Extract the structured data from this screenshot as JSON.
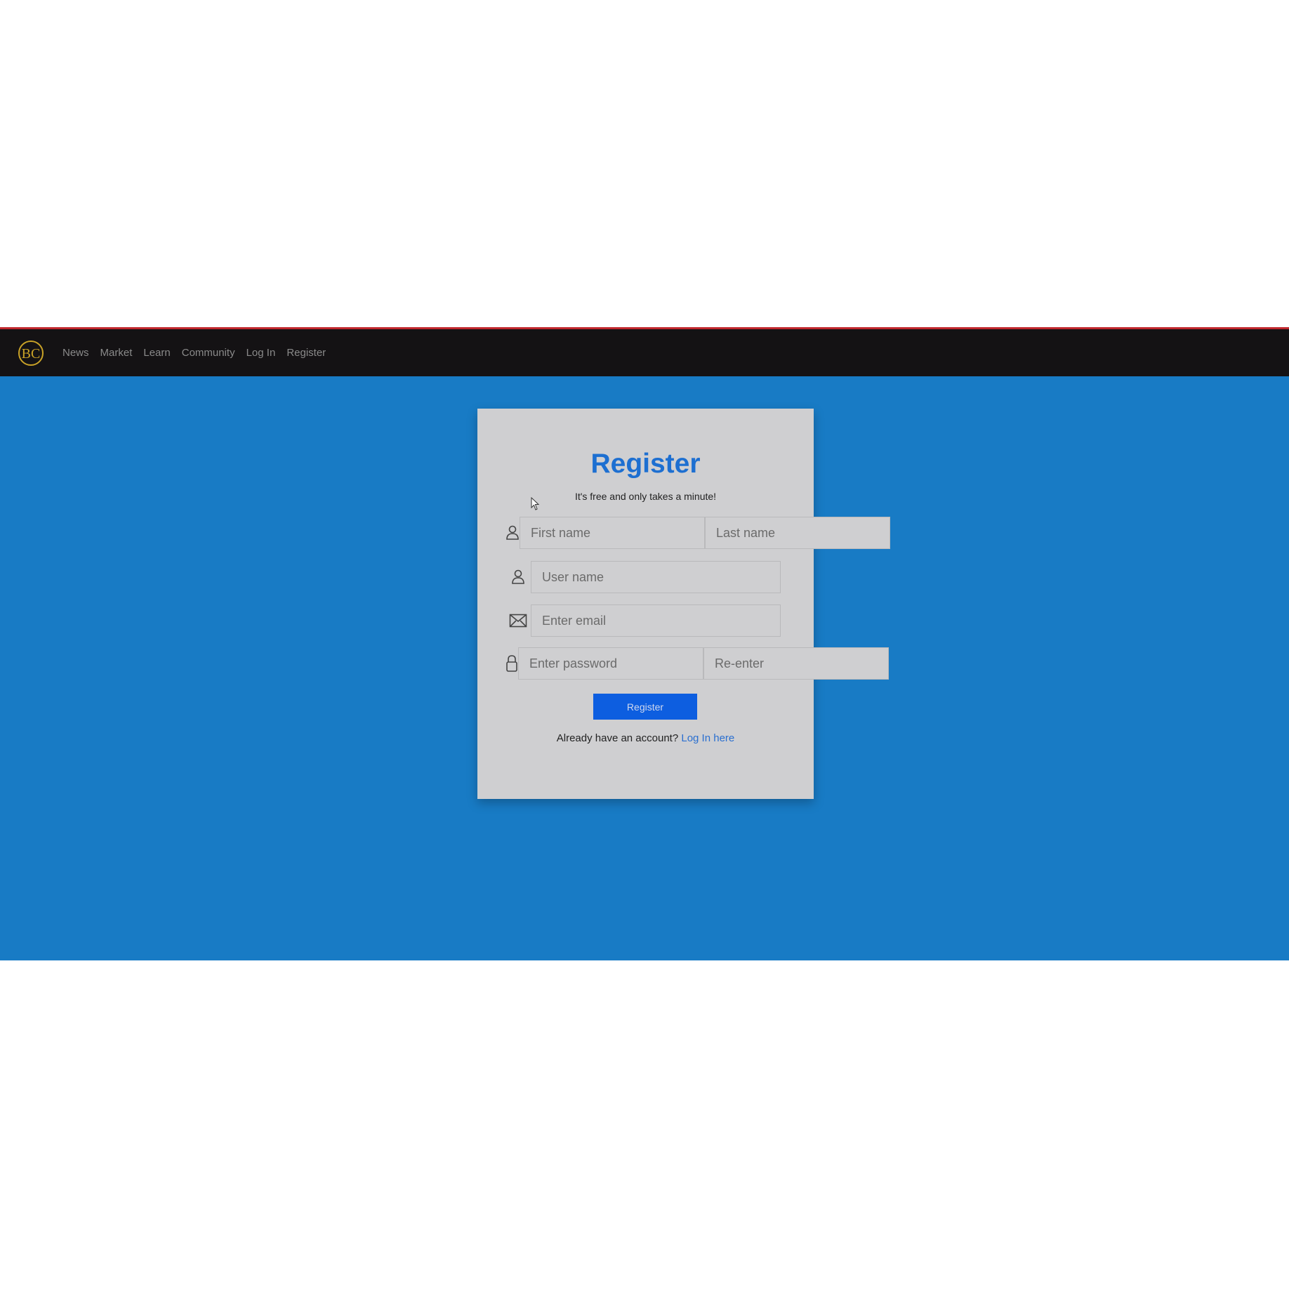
{
  "navbar": {
    "logo_letters": "BC",
    "links": [
      "News",
      "Market",
      "Learn",
      "Community",
      "Log In",
      "Register"
    ]
  },
  "form": {
    "title": "Register",
    "subtitle": "It's free and only takes a minute!",
    "first_name_placeholder": "First name",
    "last_name_placeholder": "Last name",
    "username_placeholder": "User name",
    "email_placeholder": "Enter email",
    "password_placeholder": "Enter password",
    "reenter_placeholder": "Re-enter",
    "submit_label": "Register",
    "footer_text": "Already have an account?",
    "footer_link": "Log In here"
  },
  "icons": {
    "name_row": "user-icon",
    "username_row": "user-icon",
    "email_row": "envelope-icon",
    "password_row": "lock-icon"
  },
  "colors": {
    "background": "#187bc5",
    "navbar": "#141214",
    "navbar_accent": "#c0272d",
    "card": "#cfcfd1",
    "title": "#1d6fd1",
    "button": "#0d5ee0",
    "logo": "#c9a227"
  }
}
